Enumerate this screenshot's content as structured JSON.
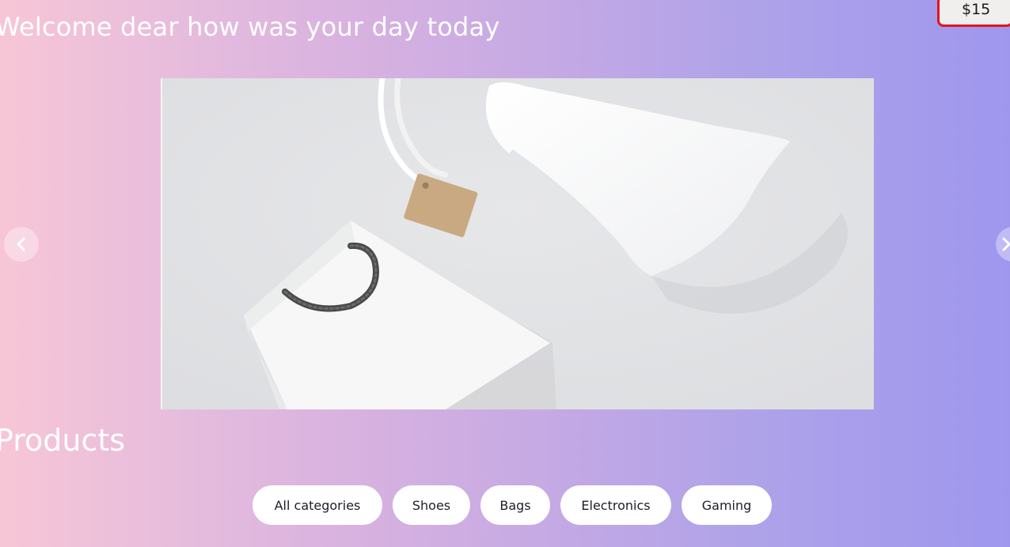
{
  "header": {
    "welcome_text": "Welcome dear how was your day today"
  },
  "cart": {
    "total": "$15"
  },
  "carousel": {
    "prev_icon": "chevron-left-icon",
    "next_icon": "chevron-right-icon"
  },
  "products": {
    "title": "Products",
    "categories": [
      {
        "label": "All categories"
      },
      {
        "label": "Shoes"
      },
      {
        "label": "Bags"
      },
      {
        "label": "Electronics"
      },
      {
        "label": "Gaming"
      }
    ]
  },
  "colors": {
    "gradient_start": "#f7c6d6",
    "gradient_end": "#9f97ee",
    "cart_border": "#e3131b"
  }
}
